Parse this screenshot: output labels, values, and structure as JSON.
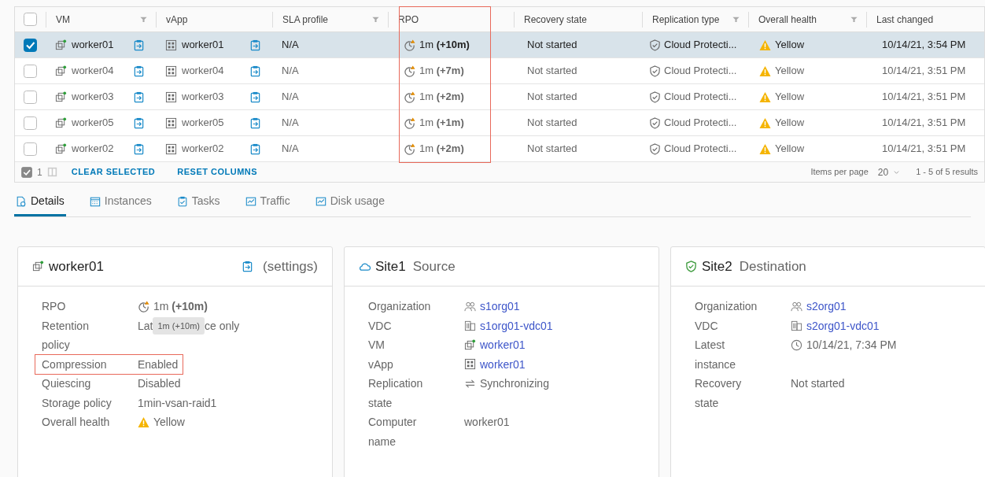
{
  "table": {
    "columns": [
      {
        "label": "VM",
        "filter": true,
        "highlighted": false
      },
      {
        "label": "vApp",
        "filter": false,
        "highlighted": false
      },
      {
        "label": "SLA profile",
        "filter": true,
        "highlighted": false
      },
      {
        "label": "RPO",
        "filter": false,
        "highlighted": true
      },
      {
        "label": "Recovery state",
        "filter": false,
        "highlighted": false
      },
      {
        "label": "Replication type",
        "filter": true,
        "highlighted": false
      },
      {
        "label": "Overall health",
        "filter": true,
        "highlighted": false
      },
      {
        "label": "Last changed",
        "filter": false,
        "highlighted": false
      }
    ],
    "all_checked": false,
    "bulk_checked": true,
    "rows": [
      {
        "selected": true,
        "vm": "worker01",
        "vapp": "worker01",
        "sla": "N/A",
        "rpo": "1m **(+10m)**",
        "recovery": "Not started",
        "replication": "Cloud Protecti...",
        "health": "Yellow",
        "changed": "10/14/21, 3:54 PM"
      },
      {
        "selected": false,
        "vm": "worker04",
        "vapp": "worker04",
        "sla": "N/A",
        "rpo": "1m **(+7m)**",
        "recovery": "Not started",
        "replication": "Cloud Protecti...",
        "health": "Yellow",
        "changed": "10/14/21, 3:51 PM"
      },
      {
        "selected": false,
        "vm": "worker03",
        "vapp": "worker03",
        "sla": "N/A",
        "rpo": "1m **(+2m)**",
        "recovery": "Not started",
        "replication": "Cloud Protecti...",
        "health": "Yellow",
        "changed": "10/14/21, 3:51 PM"
      },
      {
        "selected": false,
        "vm": "worker05",
        "vapp": "worker05",
        "sla": "N/A",
        "rpo": "1m **(+1m)**",
        "recovery": "Not started",
        "replication": "Cloud Protecti...",
        "health": "Yellow",
        "changed": "10/14/21, 3:51 PM"
      },
      {
        "selected": false,
        "vm": "worker02",
        "vapp": "worker02",
        "sla": "N/A",
        "rpo": "1m **(+2m)**",
        "recovery": "Not started",
        "replication": "Cloud Protecti...",
        "health": "Yellow",
        "changed": "10/14/21, 3:51 PM"
      }
    ],
    "footer": {
      "selected_count": "1",
      "actions": [
        "CLEAR SELECTED",
        "RESET COLUMNS"
      ],
      "items_per_page_label": "Items per page",
      "items_per_page": "20",
      "range": "1 - 5 of 5 results"
    }
  },
  "tabs": [
    {
      "label": "Details",
      "kind": "details",
      "selected": true
    },
    {
      "label": "Instances",
      "kind": "calendar",
      "selected": false
    },
    {
      "label": "Tasks",
      "kind": "tasks",
      "selected": false
    },
    {
      "label": "Traffic",
      "kind": "chart",
      "selected": false
    },
    {
      "label": "Disk usage",
      "kind": "chart",
      "selected": false
    }
  ],
  "cards": [
    {
      "kind": "vm",
      "title": "worker01",
      "link": "(settings)",
      "rows": [
        {
          "label": "RPO",
          "kind": "rpo",
          "value": "1m **(+10m)**",
          "link": false,
          "highlighted": false
        },
        {
          "label": "Retention policy",
          "value_parts": [
            "Lat",
            "ce only"
          ],
          "tooltip": "1m (+10m)",
          "link": false,
          "highlighted": false
        },
        {
          "label": "Compression",
          "value": "Enabled",
          "link": false,
          "highlighted": true
        },
        {
          "label": "Quiescing",
          "value": "Disabled",
          "link": false,
          "highlighted": false
        },
        {
          "label": "Storage policy",
          "value": "1min-vsan-raid1",
          "link": false,
          "highlighted": false
        },
        {
          "label": "Overall health",
          "kind": "warning",
          "value": "Yellow",
          "link": false,
          "highlighted": false
        }
      ]
    },
    {
      "kind": "cloud",
      "title": "Site1",
      "subtitle": "Source",
      "rows": [
        {
          "label": "Organization",
          "kind": "org",
          "value": "s1org01",
          "link": true,
          "highlighted": false
        },
        {
          "label": "VDC",
          "kind": "vdc",
          "value": "s1org01-vdc01",
          "link": true,
          "highlighted": false
        },
        {
          "label": "VM",
          "kind": "vm",
          "value": "worker01",
          "link": true,
          "highlighted": false
        },
        {
          "label": "vApp",
          "kind": "vapp",
          "value": "worker01",
          "link": true,
          "highlighted": false
        },
        {
          "label": "Replication state",
          "kind": "sync",
          "value": "Synchronizing",
          "link": false,
          "highlighted": false
        },
        {
          "label": "Computer name",
          "value": "worker01",
          "link": false,
          "highlighted": false
        }
      ]
    },
    {
      "kind": "shield",
      "title": "Site2",
      "subtitle": "Destination",
      "rows": [
        {
          "label": "Organization",
          "kind": "org",
          "value": "s2org01",
          "link": true,
          "highlighted": false
        },
        {
          "label": "VDC",
          "kind": "vdc",
          "value": "s2org01-vdc01",
          "link": true,
          "highlighted": false
        },
        {
          "label": "Latest instance",
          "kind": "clock",
          "value": "10/14/21, 7:34 PM",
          "link": false,
          "highlighted": false
        },
        {
          "label": "Recovery state",
          "value": "Not started",
          "link": false,
          "highlighted": false
        }
      ]
    }
  ]
}
